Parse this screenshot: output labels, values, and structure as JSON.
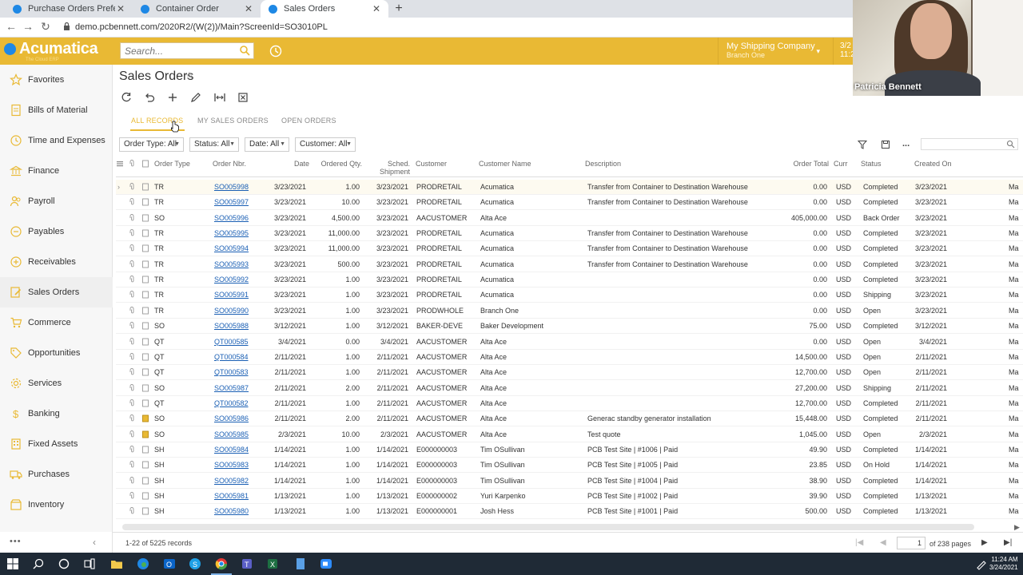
{
  "browser": {
    "tabs": [
      {
        "label": "Purchase Orders Preferences"
      },
      {
        "label": "Container Order"
      },
      {
        "label": "Sales Orders"
      }
    ],
    "url": "demo.pcbennett.com/2020R2/(W(2))/Main?ScreenId=SO3010PL"
  },
  "app": {
    "logo": "Acumatica",
    "logo_sub": "The Cloud ERP",
    "search_placeholder": "Search...",
    "company_name": "My Shipping Company",
    "branch": "Branch One",
    "date_short": "3/2",
    "date_short2": "11:2"
  },
  "video": {
    "name": "Patricia Bennett"
  },
  "sidebar": {
    "items": [
      {
        "label": "Favorites",
        "icon": "star-icon"
      },
      {
        "label": "Bills of Material",
        "icon": "document-icon"
      },
      {
        "label": "Time and Expenses",
        "icon": "clock-icon"
      },
      {
        "label": "Finance",
        "icon": "bank-icon"
      },
      {
        "label": "Payroll",
        "icon": "people-icon"
      },
      {
        "label": "Payables",
        "icon": "minus-circle-icon"
      },
      {
        "label": "Receivables",
        "icon": "plus-circle-icon"
      },
      {
        "label": "Sales Orders",
        "icon": "pencil-icon"
      },
      {
        "label": "Commerce",
        "icon": "cart-icon"
      },
      {
        "label": "Opportunities",
        "icon": "tag-icon"
      },
      {
        "label": "Services",
        "icon": "gear-icon"
      },
      {
        "label": "Banking",
        "icon": "dollar-icon"
      },
      {
        "label": "Fixed Assets",
        "icon": "building-icon"
      },
      {
        "label": "Purchases",
        "icon": "truck-icon"
      },
      {
        "label": "Inventory",
        "icon": "box-icon"
      }
    ],
    "active": "Sales Orders"
  },
  "page": {
    "title": "Sales Orders",
    "subtabs": [
      "ALL RECORDS",
      "MY SALES ORDERS",
      "OPEN ORDERS"
    ],
    "filters": [
      "Order Type: All",
      "Status: All",
      "Date: All",
      "Customer: All"
    ],
    "more": "..."
  },
  "grid": {
    "headers": {
      "order_type": "Order Type",
      "order_nbr": "Order Nbr.",
      "date": "Date",
      "ordered_qty": "Ordered Qty.",
      "sched_1": "Sched.",
      "sched_2": "Shipment",
      "customer": "Customer",
      "customer_name": "Customer Name",
      "description": "Description",
      "order_total": "Order Total",
      "curr": "Curr",
      "status": "Status",
      "created_on": "Created On"
    },
    "rows": [
      {
        "type": "TR",
        "nbr": "SO005998",
        "date": "3/23/2021",
        "qty": "1.00",
        "ship": "3/23/2021",
        "cust": "PRODRETAIL",
        "name": "Acumatica",
        "desc": "Transfer from Container to Destination Warehouse",
        "total": "0.00",
        "curr": "USD",
        "status": "Completed",
        "created": "3/23/2021",
        "extra": "Ma"
      },
      {
        "type": "TR",
        "nbr": "SO005997",
        "date": "3/23/2021",
        "qty": "10.00",
        "ship": "3/23/2021",
        "cust": "PRODRETAIL",
        "name": "Acumatica",
        "desc": "Transfer from Container to Destination Warehouse",
        "total": "0.00",
        "curr": "USD",
        "status": "Completed",
        "created": "3/23/2021",
        "extra": "Ma"
      },
      {
        "type": "SO",
        "nbr": "SO005996",
        "date": "3/23/2021",
        "qty": "4,500.00",
        "ship": "3/23/2021",
        "cust": "AACUSTOMER",
        "name": "Alta Ace",
        "desc": "",
        "total": "405,000.00",
        "curr": "USD",
        "status": "Back Order",
        "created": "3/23/2021",
        "extra": "Ma"
      },
      {
        "type": "TR",
        "nbr": "SO005995",
        "date": "3/23/2021",
        "qty": "11,000.00",
        "ship": "3/23/2021",
        "cust": "PRODRETAIL",
        "name": "Acumatica",
        "desc": "Transfer from Container to Destination Warehouse",
        "total": "0.00",
        "curr": "USD",
        "status": "Completed",
        "created": "3/23/2021",
        "extra": "Ma"
      },
      {
        "type": "TR",
        "nbr": "SO005994",
        "date": "3/23/2021",
        "qty": "11,000.00",
        "ship": "3/23/2021",
        "cust": "PRODRETAIL",
        "name": "Acumatica",
        "desc": "Transfer from Container to Destination Warehouse",
        "total": "0.00",
        "curr": "USD",
        "status": "Completed",
        "created": "3/23/2021",
        "extra": "Ma"
      },
      {
        "type": "TR",
        "nbr": "SO005993",
        "date": "3/23/2021",
        "qty": "500.00",
        "ship": "3/23/2021",
        "cust": "PRODRETAIL",
        "name": "Acumatica",
        "desc": "Transfer from Container to Destination Warehouse",
        "total": "0.00",
        "curr": "USD",
        "status": "Completed",
        "created": "3/23/2021",
        "extra": "Ma"
      },
      {
        "type": "TR",
        "nbr": "SO005992",
        "date": "3/23/2021",
        "qty": "1.00",
        "ship": "3/23/2021",
        "cust": "PRODRETAIL",
        "name": "Acumatica",
        "desc": "",
        "total": "0.00",
        "curr": "USD",
        "status": "Completed",
        "created": "3/23/2021",
        "extra": "Ma"
      },
      {
        "type": "TR",
        "nbr": "SO005991",
        "date": "3/23/2021",
        "qty": "1.00",
        "ship": "3/23/2021",
        "cust": "PRODRETAIL",
        "name": "Acumatica",
        "desc": "",
        "total": "0.00",
        "curr": "USD",
        "status": "Shipping",
        "created": "3/23/2021",
        "extra": "Ma"
      },
      {
        "type": "TR",
        "nbr": "SO005990",
        "date": "3/23/2021",
        "qty": "1.00",
        "ship": "3/23/2021",
        "cust": "PRODWHOLE",
        "name": "Branch One",
        "desc": "",
        "total": "0.00",
        "curr": "USD",
        "status": "Open",
        "created": "3/23/2021",
        "extra": "Ma"
      },
      {
        "type": "SO",
        "nbr": "SO005988",
        "date": "3/12/2021",
        "qty": "1.00",
        "ship": "3/12/2021",
        "cust": "BAKER-DEVE",
        "name": "Baker Development",
        "desc": "",
        "total": "75.00",
        "curr": "USD",
        "status": "Completed",
        "created": "3/12/2021",
        "extra": "Ma"
      },
      {
        "type": "QT",
        "nbr": "QT000585",
        "date": "3/4/2021",
        "qty": "0.00",
        "ship": "3/4/2021",
        "cust": "AACUSTOMER",
        "name": "Alta Ace",
        "desc": "",
        "total": "0.00",
        "curr": "USD",
        "status": "Open",
        "created": "3/4/2021",
        "extra": "Ma"
      },
      {
        "type": "QT",
        "nbr": "QT000584",
        "date": "2/11/2021",
        "qty": "1.00",
        "ship": "2/11/2021",
        "cust": "AACUSTOMER",
        "name": "Alta Ace",
        "desc": "",
        "total": "14,500.00",
        "curr": "USD",
        "status": "Open",
        "created": "2/11/2021",
        "extra": "Ma"
      },
      {
        "type": "QT",
        "nbr": "QT000583",
        "date": "2/11/2021",
        "qty": "1.00",
        "ship": "2/11/2021",
        "cust": "AACUSTOMER",
        "name": "Alta Ace",
        "desc": "",
        "total": "12,700.00",
        "curr": "USD",
        "status": "Open",
        "created": "2/11/2021",
        "extra": "Ma"
      },
      {
        "type": "SO",
        "nbr": "SO005987",
        "date": "2/11/2021",
        "qty": "2.00",
        "ship": "2/11/2021",
        "cust": "AACUSTOMER",
        "name": "Alta Ace",
        "desc": "",
        "total": "27,200.00",
        "curr": "USD",
        "status": "Shipping",
        "created": "2/11/2021",
        "extra": "Ma"
      },
      {
        "type": "QT",
        "nbr": "QT000582",
        "date": "2/11/2021",
        "qty": "1.00",
        "ship": "2/11/2021",
        "cust": "AACUSTOMER",
        "name": "Alta Ace",
        "desc": "",
        "total": "12,700.00",
        "curr": "USD",
        "status": "Completed",
        "created": "2/11/2021",
        "extra": "Ma"
      },
      {
        "type": "SO",
        "nbr": "SO005986",
        "date": "2/11/2021",
        "qty": "2.00",
        "ship": "2/11/2021",
        "cust": "AACUSTOMER",
        "name": "Alta Ace",
        "desc": "Generac standby generator installation",
        "total": "15,448.00",
        "curr": "USD",
        "status": "Completed",
        "created": "2/11/2021",
        "extra": "Ma"
      },
      {
        "type": "SO",
        "nbr": "SO005985",
        "date": "2/3/2021",
        "qty": "10.00",
        "ship": "2/3/2021",
        "cust": "AACUSTOMER",
        "name": "Alta Ace",
        "desc": "Test quote",
        "total": "1,045.00",
        "curr": "USD",
        "status": "Open",
        "created": "2/3/2021",
        "extra": "Ma"
      },
      {
        "type": "SH",
        "nbr": "SO005984",
        "date": "1/14/2021",
        "qty": "1.00",
        "ship": "1/14/2021",
        "cust": "E000000003",
        "name": "Tim OSullivan",
        "desc": "PCB Test Site | #1006 | Paid",
        "total": "49.90",
        "curr": "USD",
        "status": "Completed",
        "created": "1/14/2021",
        "extra": "Ma"
      },
      {
        "type": "SH",
        "nbr": "SO005983",
        "date": "1/14/2021",
        "qty": "1.00",
        "ship": "1/14/2021",
        "cust": "E000000003",
        "name": "Tim OSullivan",
        "desc": "PCB Test Site | #1005 | Paid",
        "total": "23.85",
        "curr": "USD",
        "status": "On Hold",
        "created": "1/14/2021",
        "extra": "Ma"
      },
      {
        "type": "SH",
        "nbr": "SO005982",
        "date": "1/14/2021",
        "qty": "1.00",
        "ship": "1/14/2021",
        "cust": "E000000003",
        "name": "Tim OSullivan",
        "desc": "PCB Test Site | #1004 | Paid",
        "total": "38.90",
        "curr": "USD",
        "status": "Completed",
        "created": "1/14/2021",
        "extra": "Ma"
      },
      {
        "type": "SH",
        "nbr": "SO005981",
        "date": "1/13/2021",
        "qty": "1.00",
        "ship": "1/13/2021",
        "cust": "E000000002",
        "name": "Yuri Karpenko",
        "desc": "PCB Test Site | #1002 | Paid",
        "total": "39.90",
        "curr": "USD",
        "status": "Completed",
        "created": "1/13/2021",
        "extra": "Ma"
      },
      {
        "type": "SH",
        "nbr": "SO005980",
        "date": "1/13/2021",
        "qty": "1.00",
        "ship": "1/13/2021",
        "cust": "E000000001",
        "name": "Josh Hess",
        "desc": "PCB Test Site | #1001 | Paid",
        "total": "500.00",
        "curr": "USD",
        "status": "Completed",
        "created": "1/13/2021",
        "extra": "Ma"
      }
    ],
    "rows_with_note_icon": [
      15,
      16
    ]
  },
  "footer": {
    "records": "1-22 of 5225 records",
    "page": "1",
    "pages": "of 238 pages"
  },
  "taskbar": {
    "time": "11:24 AM",
    "date": "3/24/2021"
  }
}
